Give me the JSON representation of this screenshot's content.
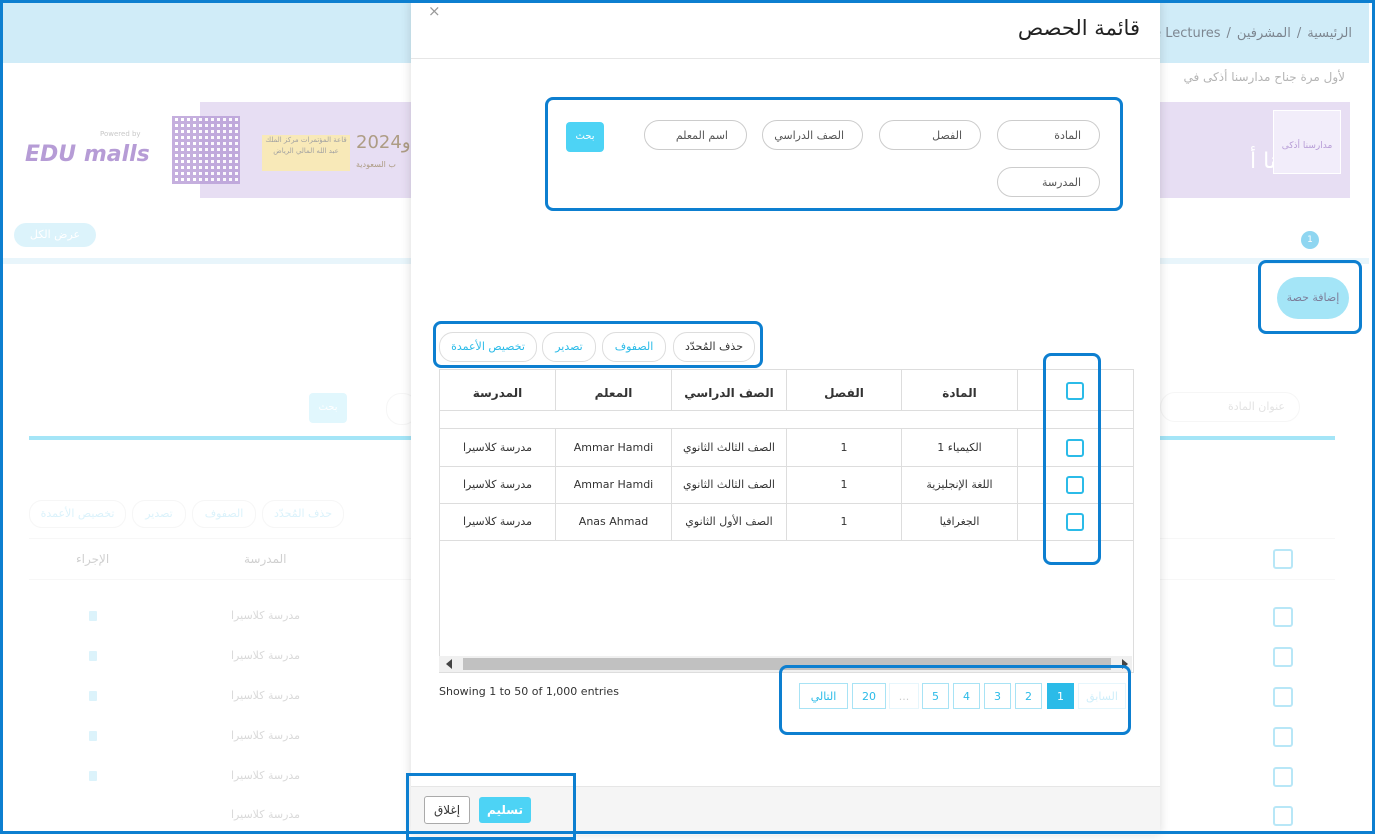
{
  "background": {
    "breadcrumb": [
      "الرئيسية",
      "/",
      "المشرفين",
      "/",
      "ge Lectures"
    ],
    "marquee": "لأول مرة جناح مدارسنا أذكى في",
    "banner": {
      "right_text_line1": "لأول م",
      "right_text_line2": "مدارسنا أ",
      "logo_small": "مدارسنا أذكى",
      "edu_logo": "EDU malls",
      "edu_powered": "Powered by",
      "ad_box": "قاعة المؤتمرات مركز الملك عبد الله المالي الرياض",
      "ad_year": "2024و",
      "ad_sub": "ب السعودية"
    },
    "show_all": "عرض الكل",
    "carousel_active": "1",
    "add_lecture": "إضافة حصة",
    "search_placeholder": "عنوان المادة",
    "search_button": "بحث",
    "tools": [
      "حذف المُحدّد",
      "الصفوف",
      "تصدير",
      "تخصيص الأعمدة"
    ],
    "table_headers": [
      "المدرسة",
      "الإجراء"
    ],
    "rows": [
      "مدرسة كلاسيرا",
      "مدرسة كلاسيرا",
      "مدرسة كلاسيرا",
      "مدرسة كلاسيرا",
      "مدرسة كلاسيرا",
      "مدرسة كلاسيرا"
    ]
  },
  "modal": {
    "title": "قائمة الحصص",
    "close_symbol": "×",
    "filters": {
      "subject": "المادة",
      "class": "الفصل",
      "grade": "الصف الدراسي",
      "teacher": "اسم المعلم",
      "school": "المدرسة",
      "search_button": "بحث"
    },
    "tools": {
      "delete_selected": "حذف المُحدّد",
      "rows": "الصفوف",
      "export": "تصدير",
      "customize_columns": "تخصيص الأعمدة"
    },
    "table": {
      "headers": {
        "subject": "المادة",
        "class": "الفصل",
        "grade": "الصف الدراسي",
        "teacher": "المعلم",
        "school": "المدرسة"
      },
      "rows": [
        {
          "subject": "الكيمياء 1",
          "class": "1",
          "grade": "الصف الثالث الثانوي",
          "teacher": "Ammar Hamdi",
          "school": "مدرسة كلاسيرا"
        },
        {
          "subject": "اللغة الإنجليزية",
          "class": "1",
          "grade": "الصف الثالث الثانوي",
          "teacher": "Ammar Hamdi",
          "school": "مدرسة كلاسيرا"
        },
        {
          "subject": "الجغرافيا",
          "class": "1",
          "grade": "الصف الأول الثانوي",
          "teacher": "Anas Ahmad",
          "school": "مدرسة كلاسيرا"
        }
      ]
    },
    "showing": "Showing 1 to 50 of 1,000 entries",
    "pagination": {
      "prev": "السابق",
      "pages": [
        "1",
        "2",
        "3",
        "4",
        "5",
        "...",
        "20"
      ],
      "next": "التالي",
      "active": "1"
    },
    "footer": {
      "submit": "تسليم",
      "close": "إغلاق"
    }
  }
}
